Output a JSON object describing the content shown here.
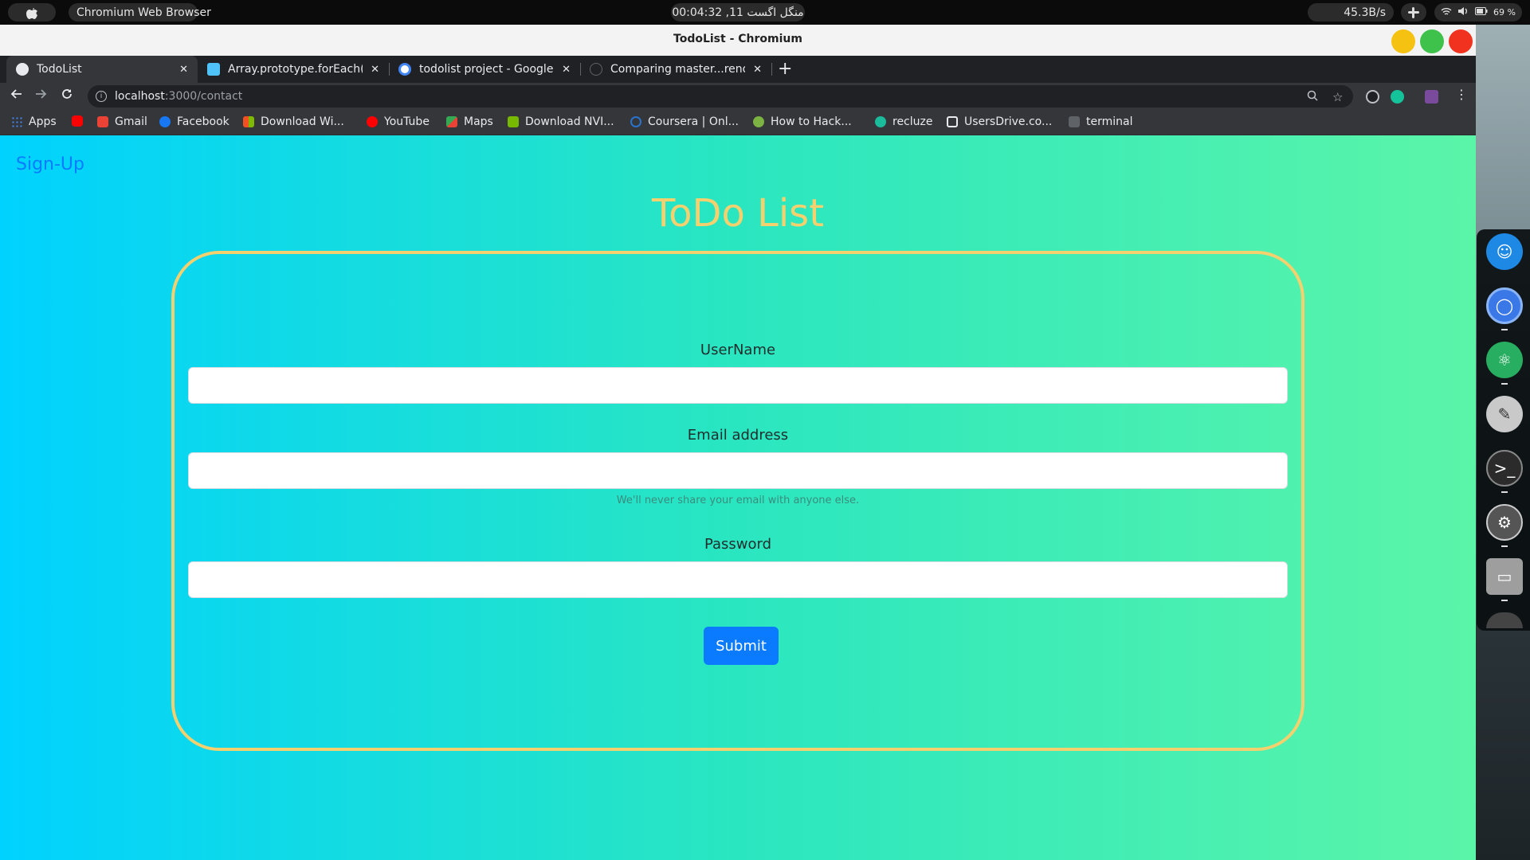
{
  "system_bar": {
    "app_name": "Chromium Web Browser",
    "clock": "00:04:32 ,11 منگل اگست",
    "net_speed": "45.3B/s",
    "battery": "69 %"
  },
  "window": {
    "title": "TodoList - Chromium"
  },
  "tabs": [
    {
      "label": "TodoList",
      "favicon_color": "#ffffff"
    },
    {
      "label": "Array.prototype.forEach(",
      "favicon_color": "#4fc3f7"
    },
    {
      "label": "todolist project - Google S",
      "favicon_color": "#ffffff"
    },
    {
      "label": "Comparing master...renov",
      "favicon_color": "#202124"
    }
  ],
  "toolbar": {
    "url_host": "localhost",
    "url_path": ":3000/contact"
  },
  "bookmarks": [
    {
      "label": "Apps",
      "color": "#4285f4"
    },
    {
      "label": "",
      "color": "#ff0000"
    },
    {
      "label": "Gmail",
      "color": "#ea4335"
    },
    {
      "label": "Facebook",
      "color": "#1877f2"
    },
    {
      "label": "Download Wi...",
      "color": "#f25022"
    },
    {
      "label": "YouTube",
      "color": "#ff0000"
    },
    {
      "label": "Maps",
      "color": "#34a853"
    },
    {
      "label": "Download NVI...",
      "color": "#76b900"
    },
    {
      "label": "Coursera | Onl...",
      "color": "#2a73cc"
    },
    {
      "label": "How to Hack...",
      "color": "#7cb342"
    },
    {
      "label": "recluze",
      "color": "#1abc9c"
    },
    {
      "label": "UsersDrive.co...",
      "color": "#e8eaed"
    },
    {
      "label": "terminal",
      "color": "#5f6368"
    }
  ],
  "page": {
    "nav_link": "Sign-Up",
    "title": "ToDo List",
    "fields": {
      "username_label": "UserName",
      "email_label": "Email address",
      "email_help": "We'll never share your email with anyone else.",
      "password_label": "Password",
      "username_value": "",
      "email_value": "",
      "password_value": ""
    },
    "submit_label": "Submit"
  },
  "colors": {
    "gradient_start": "#00d2ff",
    "gradient_end": "#5bf5a8",
    "accent_gold": "#f4d06f",
    "primary_blue": "#0a7bff"
  }
}
